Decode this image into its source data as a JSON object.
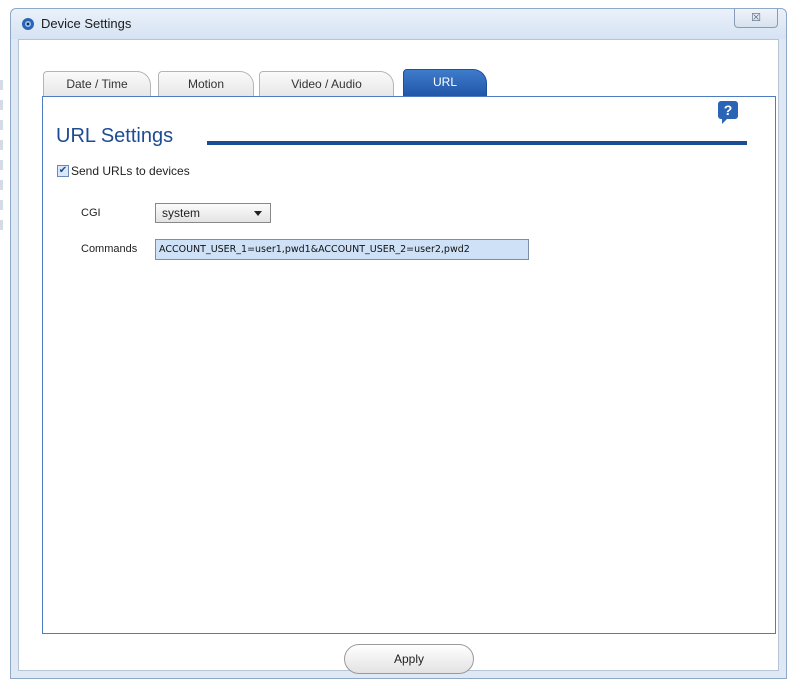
{
  "window": {
    "title": "Device Settings",
    "close_glyph": "☒"
  },
  "tabs": [
    {
      "label": "Date / Time",
      "active": false
    },
    {
      "label": "Motion",
      "active": false
    },
    {
      "label": "Video / Audio",
      "active": false
    },
    {
      "label": "URL",
      "active": true
    }
  ],
  "panel": {
    "heading": "URL Settings",
    "help_glyph": "?",
    "send_urls": {
      "label": "Send URLs to devices",
      "checked": true,
      "check_glyph": "✔"
    },
    "cgi": {
      "label": "CGI",
      "value": "system"
    },
    "commands": {
      "label": "Commands",
      "value": "ACCOUNT_USER_1=user1,pwd1&ACCOUNT_USER_2=user2,pwd2"
    }
  },
  "footer": {
    "apply_label": "Apply"
  },
  "colors": {
    "accent": "#1d4c96",
    "tab_active": "#2a64b5",
    "field_bg": "#cfe1f7"
  },
  "icons": {
    "app": "camera-icon",
    "help": "help-icon",
    "close": "close-icon"
  }
}
